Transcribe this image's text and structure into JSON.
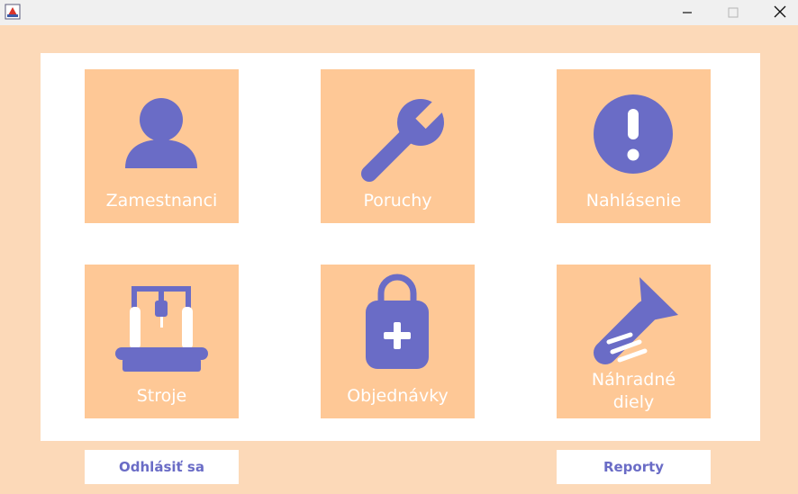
{
  "colors": {
    "background": "#fcd9b8",
    "panel": "#ffffff",
    "tile": "#fec896",
    "icon": "#6a6cc6",
    "label": "#ffffff"
  },
  "window": {
    "app_icon": "java-app-icon",
    "minimize_icon": "minimize-icon",
    "maximize_icon": "maximize-icon",
    "close_icon": "close-icon"
  },
  "tiles": [
    {
      "label": "Zamestnanci",
      "icon": "person-icon"
    },
    {
      "label": "Poruchy",
      "icon": "wrench-icon"
    },
    {
      "label": "Nahlásenie",
      "icon": "alert-icon"
    },
    {
      "label": "Stroje",
      "icon": "machine-icon"
    },
    {
      "label": "Objednávky",
      "icon": "shopping-bag-plus-icon"
    },
    {
      "label_line1": "Náhradné",
      "label_line2": "diely",
      "icon": "screw-icon"
    }
  ],
  "buttons": {
    "logout": "Odhlásiť sa",
    "reports": "Reporty"
  }
}
